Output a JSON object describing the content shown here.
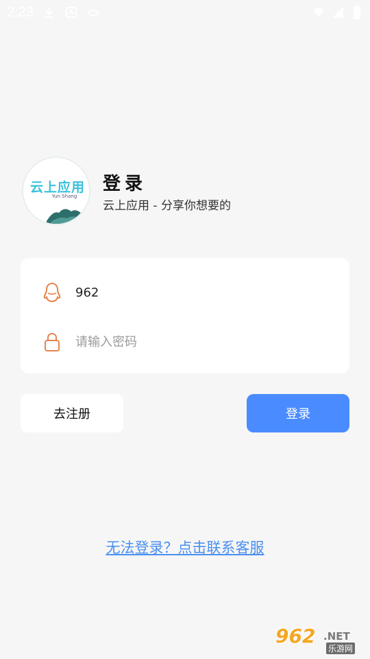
{
  "status_bar": {
    "time": "2:23",
    "icons": [
      "download-icon",
      "notification-icon",
      "cloud-icon",
      "wifi-icon",
      "signal-icon",
      "battery-icon"
    ]
  },
  "header": {
    "logo_text": "云上应用",
    "logo_subtext": "Yun Shang",
    "title": "登录",
    "subtitle": "云上应用 - 分享你想要的"
  },
  "form": {
    "account_value": "962",
    "account_icon": "qq-icon",
    "password_placeholder": "请输入密码",
    "password_icon": "lock-icon"
  },
  "buttons": {
    "register_label": "去注册",
    "login_label": "登录"
  },
  "help_link": "无法登录？点击联系客服",
  "watermark": {
    "number": "962",
    "net": ".NET",
    "cn": "乐游网"
  },
  "colors": {
    "accent": "#4a8cff",
    "icon_orange": "#e8834a",
    "link": "#4a8ff0",
    "background": "#f6f6f6"
  }
}
